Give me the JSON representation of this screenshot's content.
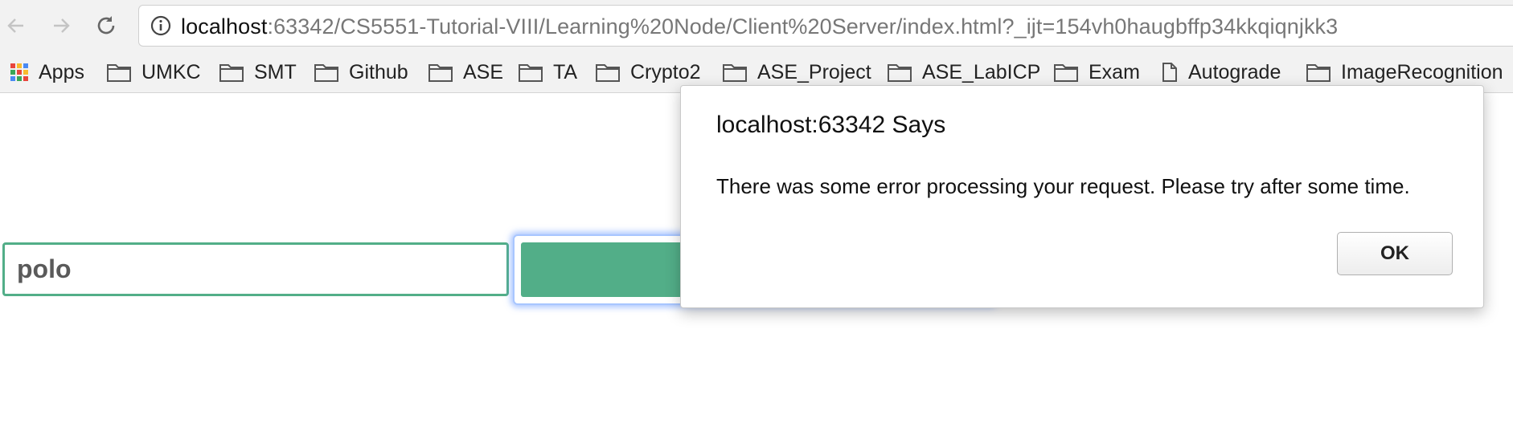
{
  "browser": {
    "url_host": "localhost",
    "url_rest": ":63342/CS5551-Tutorial-VIII/Learning%20Node/Client%20Server/index.html?_ijt=154vh0haugbffp34kkqiqnjkk3",
    "icons": [
      "back-arrow-icon",
      "forward-arrow-icon",
      "reload-icon",
      "info-icon"
    ]
  },
  "bookmarks": [
    {
      "label": "Apps",
      "icon": "apps-grid-icon"
    },
    {
      "label": "UMKC",
      "icon": "folder-icon"
    },
    {
      "label": "SMT",
      "icon": "folder-icon"
    },
    {
      "label": "Github",
      "icon": "folder-icon"
    },
    {
      "label": "ASE",
      "icon": "folder-icon"
    },
    {
      "label": "TA",
      "icon": "folder-icon"
    },
    {
      "label": "Crypto2",
      "icon": "folder-icon"
    },
    {
      "label": "ASE_Project",
      "icon": "folder-icon"
    },
    {
      "label": "ASE_LabICP",
      "icon": "folder-icon"
    },
    {
      "label": "Exam",
      "icon": "folder-icon"
    },
    {
      "label": "Autograde",
      "icon": "page-icon"
    },
    {
      "label": "ImageRecognition",
      "icon": "folder-icon"
    }
  ],
  "page": {
    "input_value": "polo",
    "accent_color": "#52ae88"
  },
  "dialog": {
    "title": "localhost:63342 Says",
    "message": "There was some error processing your request. Please try after some time.",
    "ok_label": "OK"
  }
}
